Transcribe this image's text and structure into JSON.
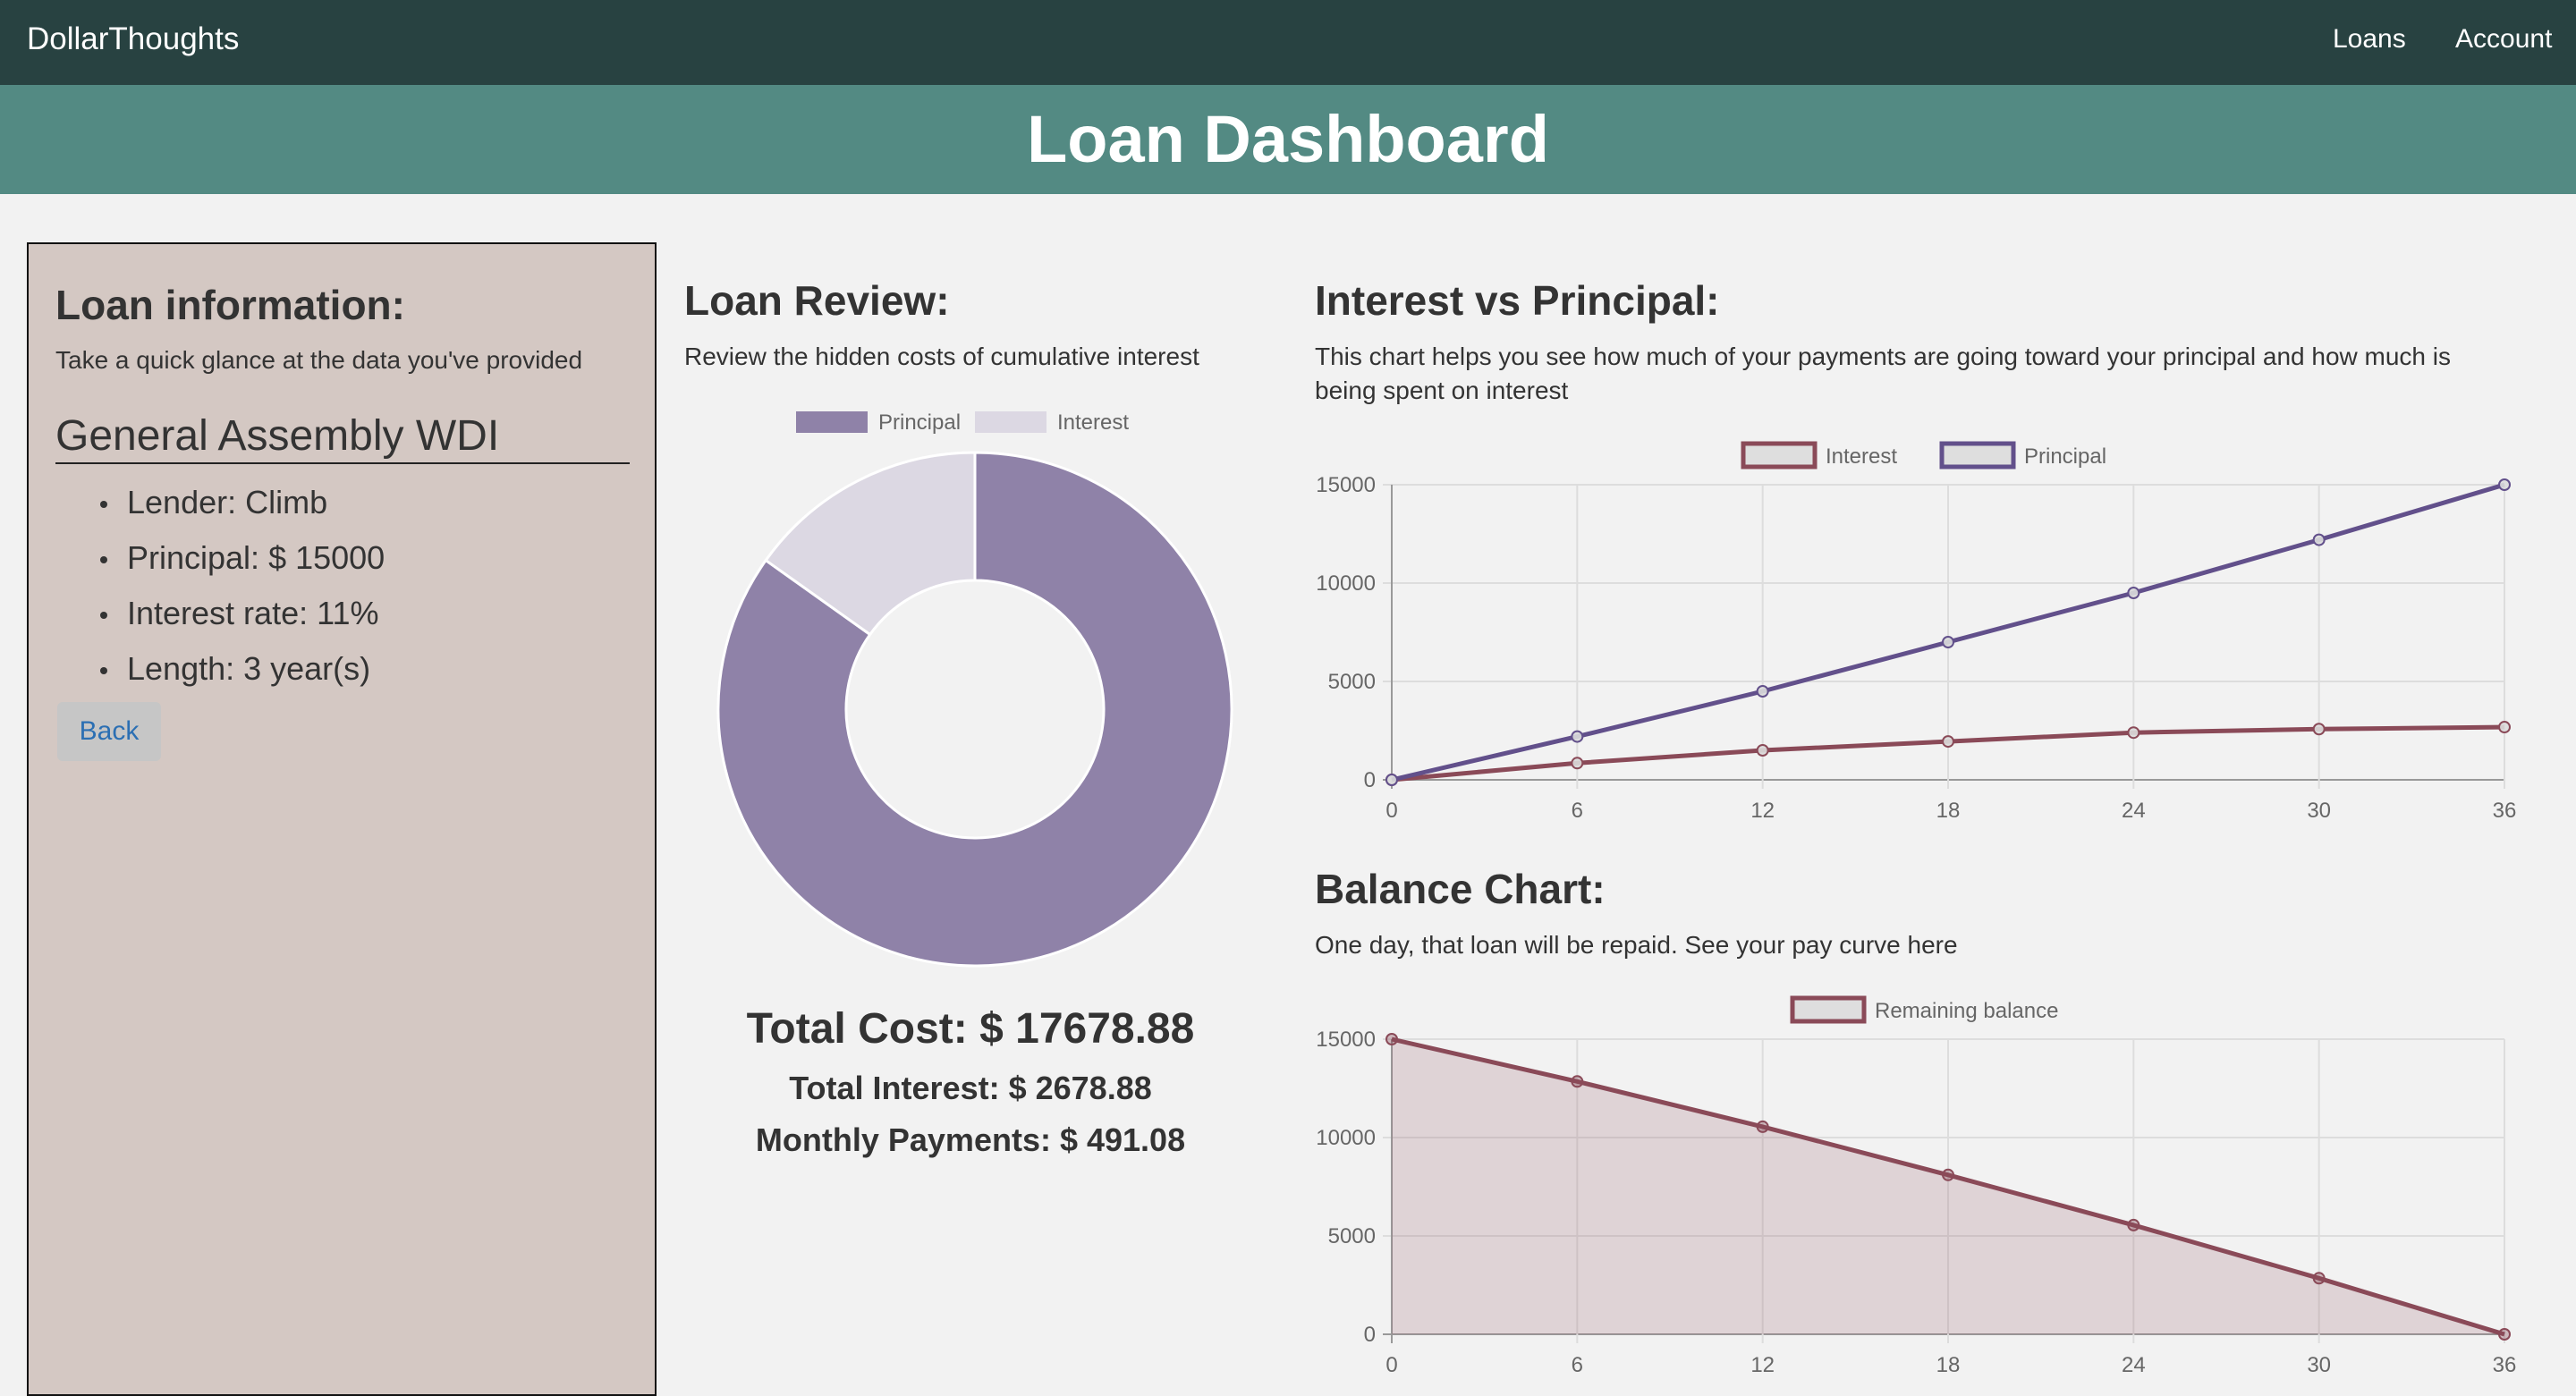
{
  "nav": {
    "brand": "DollarThoughts",
    "links": [
      "Loans",
      "Account"
    ]
  },
  "banner": {
    "title": "Loan Dashboard"
  },
  "loan_info": {
    "title": "Loan information:",
    "subtitle": "Take a quick glance at the data you've provided",
    "loan_name": "General Assembly WDI",
    "details": [
      "Lender: Climb",
      "Principal: $ 15000",
      "Interest rate: 11%",
      "Length: 3 year(s)"
    ],
    "back_label": "Back"
  },
  "review": {
    "title": "Loan Review:",
    "subtitle": "Review the hidden costs of cumulative interest",
    "total_cost": "Total Cost: $ 17678.88",
    "total_interest": "Total Interest: $ 2678.88",
    "monthly_payments": "Monthly Payments: $ 491.08"
  },
  "ivp": {
    "title": "Interest vs Principal:",
    "subtitle_line1": "This chart helps you see how much of your payments are going toward your principal and how much is",
    "subtitle_line2": "being spent on interest"
  },
  "balance": {
    "title": "Balance Chart:",
    "subtitle": "One day, that loan will be repaid. See your pay curve here"
  },
  "colors": {
    "nav_bg": "#284241",
    "banner_bg": "#538a83",
    "panel_bg": "#d4c8c3",
    "principal": "#8f82a8",
    "interest": "#dcd8e3",
    "interest_line": "#8a4a58",
    "principal_line": "#62508b"
  },
  "chart_data": [
    {
      "type": "pie",
      "variant": "doughnut",
      "labels": [
        "Principal",
        "Interest"
      ],
      "values": [
        15000,
        2678.88
      ],
      "colors": [
        "#8f82a8",
        "#dcd8e3"
      ],
      "legend": "top"
    },
    {
      "type": "line",
      "x": [
        0,
        6,
        12,
        18,
        24,
        30,
        36
      ],
      "series": [
        {
          "name": "Interest",
          "values": [
            0,
            850,
            1500,
            1950,
            2400,
            2580,
            2680
          ],
          "color": "#8a4a58"
        },
        {
          "name": "Principal",
          "values": [
            0,
            2200,
            4500,
            7000,
            9500,
            12200,
            15000
          ],
          "color": "#62508b"
        }
      ],
      "xticks": [
        "0",
        "6",
        "12",
        "18",
        "24",
        "30",
        "36"
      ],
      "yticks": [
        "15000",
        "10000",
        "5000",
        "0"
      ],
      "ylim": [
        0,
        15000
      ],
      "grid": true,
      "legend": "top"
    },
    {
      "type": "area",
      "x": [
        0,
        6,
        12,
        18,
        24,
        30,
        36
      ],
      "series": [
        {
          "name": "Remaining balance",
          "values": [
            15000,
            12850,
            10550,
            8100,
            5550,
            2850,
            0
          ],
          "color": "#8a4a58"
        }
      ],
      "xticks": [
        "0",
        "6",
        "12",
        "18",
        "24",
        "30",
        "36"
      ],
      "yticks": [
        "15000",
        "10000",
        "5000",
        "0"
      ],
      "ylim": [
        0,
        15000
      ],
      "grid": true,
      "legend": "top"
    }
  ]
}
